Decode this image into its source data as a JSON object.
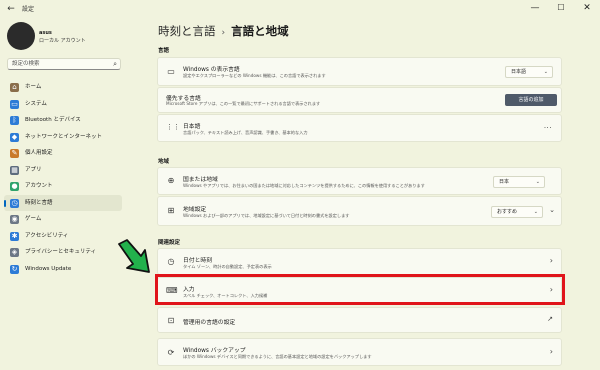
{
  "window": {
    "app_title": "設定",
    "back_icon": "back-arrow-icon",
    "controls": {
      "minimize": "—",
      "maximize": "☐",
      "close": "✕"
    }
  },
  "profile": {
    "name": "asus",
    "account_type": "ローカル アカウント"
  },
  "search": {
    "placeholder": "設定の検索"
  },
  "sidebar": {
    "items": [
      {
        "label": "ホーム",
        "icon": "home-icon",
        "color": "#8a6d4a",
        "glyph": "⌂"
      },
      {
        "label": "システム",
        "icon": "monitor-icon",
        "color": "#2d7bd6",
        "glyph": "▭"
      },
      {
        "label": "Bluetooth とデバイス",
        "icon": "bluetooth-icon",
        "color": "#2d7bd6",
        "glyph": "ᛒ"
      },
      {
        "label": "ネットワークとインターネット",
        "icon": "wifi-icon",
        "color": "#2d7bd6",
        "glyph": "◆"
      },
      {
        "label": "個人用設定",
        "icon": "brush-icon",
        "color": "#c97a2a",
        "glyph": "✎"
      },
      {
        "label": "アプリ",
        "icon": "apps-icon",
        "color": "#5d6b7d",
        "glyph": "▦"
      },
      {
        "label": "アカウント",
        "icon": "account-icon",
        "color": "#2fa36b",
        "glyph": "●"
      },
      {
        "label": "時刻と言語",
        "icon": "clock-globe-icon",
        "color": "#2d7bd6",
        "glyph": "◷"
      },
      {
        "label": "ゲーム",
        "icon": "gamepad-icon",
        "color": "#6c7785",
        "glyph": "◉"
      },
      {
        "label": "アクセシビリティ",
        "icon": "accessibility-icon",
        "color": "#2d7bd6",
        "glyph": "✱"
      },
      {
        "label": "プライバシーとセキュリティ",
        "icon": "shield-icon",
        "color": "#6c7785",
        "glyph": "◈"
      },
      {
        "label": "Windows Update",
        "icon": "update-icon",
        "color": "#2d7bd6",
        "glyph": "↻"
      }
    ],
    "active_index": 7
  },
  "breadcrumb": {
    "parent": "時刻と言語",
    "separator": "›",
    "current": "言語と地域"
  },
  "sections": {
    "language": "言語",
    "region": "地域",
    "related": "関連設定"
  },
  "cards": {
    "display_language": {
      "title": "Windows の表示言語",
      "desc": "設定やエクスプローラーなどの Windows 機能は、この言語で表示されます",
      "value": "日本語",
      "icon": "monitor-icon"
    },
    "preferred_languages": {
      "title": "優先する言語",
      "desc": "Microsoft Store アプリは、この一覧で最初にサポートされる言語で表示されます",
      "button": "言語の追加"
    },
    "japanese": {
      "title": "日本語",
      "desc": "言語パック、テキスト読み上げ、音声認識、手書き、基本的な入力",
      "icon": "language-icon",
      "more": "···"
    },
    "country": {
      "title": "国または地域",
      "desc": "Windows やアプリでは、お住まいの国または地域に対応したコンテンツを提供するために、この情報を使用することがあります",
      "value": "日本",
      "icon": "globe-icon"
    },
    "regional_format": {
      "title": "地域設定",
      "desc": "Windows および一部のアプリでは、地域設定に基づいて日付と時刻の書式を設定します",
      "value": "おすすめ",
      "icon": "regional-format-icon"
    },
    "date_time": {
      "title": "日付と時刻",
      "desc": "タイム ゾーン、時計の自動設定、予定表の表示",
      "icon": "calendar-clock-icon"
    },
    "input": {
      "title": "入力",
      "desc": "スペル チェック、オートコレクト、入力候補",
      "icon": "keyboard-icon"
    },
    "admin_language": {
      "title": "管理用の言語の設定",
      "icon": "admin-language-icon",
      "link_icon": "external-link-icon"
    },
    "backup": {
      "title": "Windows バックアップ",
      "desc": "ほかの Windows デバイスと同期できるように、言語の基本設定と地域の設定をバックアップします",
      "icon": "backup-icon"
    }
  },
  "annotation": {
    "highlight_color": "#e0141a",
    "arrow_color": "#22b14c"
  }
}
